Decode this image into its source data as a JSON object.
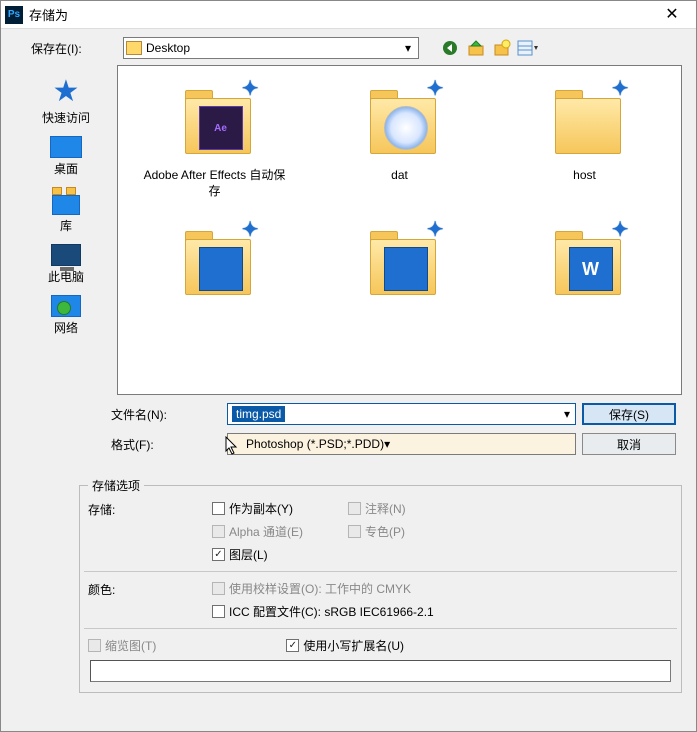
{
  "title": "存储为",
  "location": {
    "label": "保存在(I):",
    "value": "Desktop"
  },
  "nav_icons": [
    "back-icon",
    "up-icon",
    "new-folder-icon",
    "view-icon"
  ],
  "sidebar": {
    "items": [
      {
        "label": "快速访问"
      },
      {
        "label": "桌面"
      },
      {
        "label": "库"
      },
      {
        "label": "此电脑"
      },
      {
        "label": "网络"
      }
    ]
  },
  "files": [
    {
      "label": "Adobe After Effects 自动保存",
      "inner": "ae"
    },
    {
      "label": "dat",
      "inner": "disc"
    },
    {
      "label": "host",
      "inner": "plain"
    },
    {
      "label": "",
      "inner": "blue"
    },
    {
      "label": "",
      "inner": "blue"
    },
    {
      "label": "",
      "inner": "wps"
    }
  ],
  "filename": {
    "label": "文件名(N):",
    "value": "timg.psd"
  },
  "format": {
    "label": "格式(F):",
    "value": "Photoshop (*.PSD;*.PDD)"
  },
  "buttons": {
    "save": "保存(S)",
    "cancel": "取消"
  },
  "options": {
    "legend": "存储选项",
    "store_label": "存储:",
    "ascopy": "作为副本(Y)",
    "notes": "注释(N)",
    "alpha": "Alpha 通道(E)",
    "spot": "专色(P)",
    "layers": "图层(L)",
    "color_label": "颜色:",
    "proof": "使用校样设置(O): 工作中的 CMYK",
    "icc": "ICC 配置文件(C): sRGB IEC61966-2.1",
    "thumb": "缩览图(T)",
    "lowerext": "使用小写扩展名(U)"
  }
}
